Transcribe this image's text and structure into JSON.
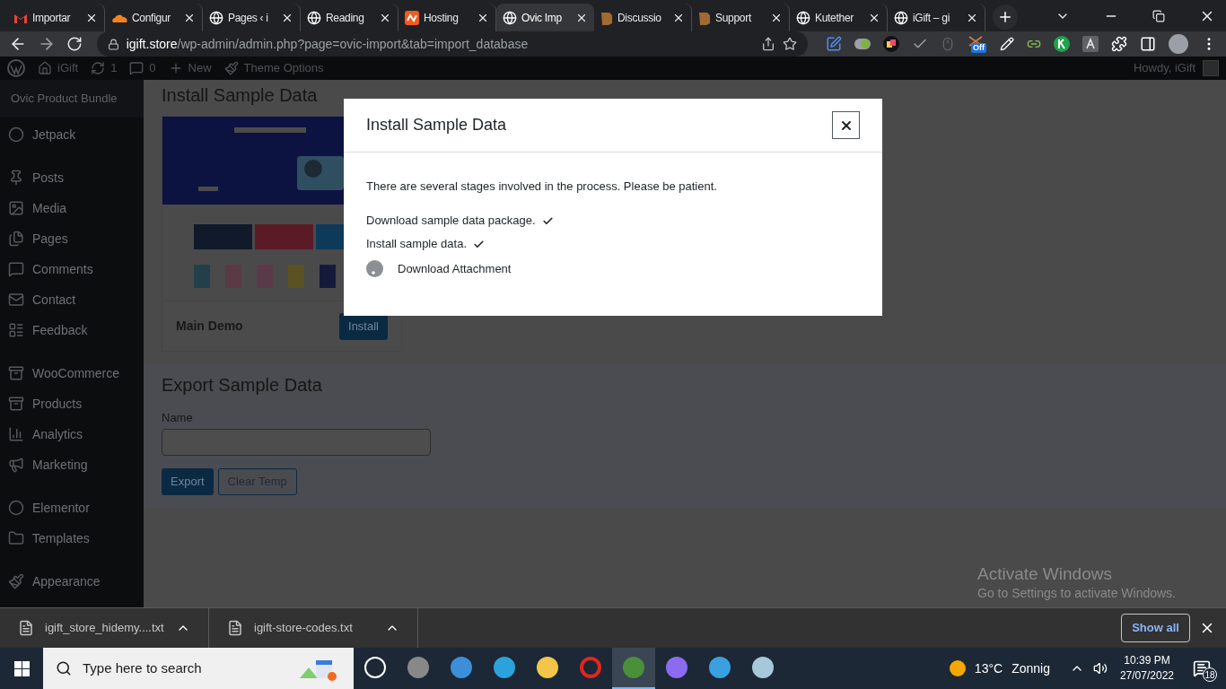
{
  "browser": {
    "tabs": [
      {
        "title": "Importar",
        "selected": false
      },
      {
        "title": "Configur",
        "selected": false
      },
      {
        "title": "Pages ‹ i",
        "selected": false
      },
      {
        "title": "Reading",
        "selected": false
      },
      {
        "title": "Hosting",
        "selected": false
      },
      {
        "title": "Ovic Imp",
        "selected": true
      },
      {
        "title": "Discussio",
        "selected": false
      },
      {
        "title": "Support",
        "selected": false
      },
      {
        "title": "Kutether",
        "selected": false
      },
      {
        "title": "iGift – gi",
        "selected": false
      }
    ],
    "address": {
      "host": "igift.store",
      "path": "/wp-admin/admin.php?page=ovic-import&tab=import_database"
    },
    "extension_badge": "Off"
  },
  "admin_bar": {
    "site": "iGift",
    "updates": "1",
    "comments": "0",
    "new": "New",
    "theme_options": "Theme Options",
    "howdy": "Howdy, iGift"
  },
  "sidebar": {
    "header": "Ovic Product Bundle",
    "groups": [
      [
        "Jetpack"
      ],
      [
        "Posts",
        "Media",
        "Pages",
        "Comments",
        "Contact",
        "Feedback"
      ],
      [
        "WooCommerce",
        "Products",
        "Analytics",
        "Marketing"
      ],
      [
        "Elementor",
        "Templates"
      ],
      [
        "Appearance"
      ]
    ]
  },
  "content": {
    "title": "Install Sample Data",
    "demo": {
      "name": "Main Demo",
      "button": "Install"
    },
    "export": {
      "title": "Export Sample Data",
      "name_label": "Name",
      "buttons": [
        "Export",
        "Clear Temp"
      ]
    }
  },
  "modal": {
    "title": "Install Sample Data",
    "intro": "There are several stages involved in the process. Please be patient.",
    "steps": [
      {
        "label": "Download sample data package.",
        "done": true
      },
      {
        "label": "Install sample data.",
        "done": true
      },
      {
        "label": "Download Attachment",
        "done": false
      }
    ]
  },
  "downloads": {
    "files": [
      "igift_store_hidemy....txt",
      "igift-store-codes.txt"
    ],
    "show_all": "Show all"
  },
  "activation_notice": {
    "title": "Activate Windows",
    "text": "Go to Settings to activate Windows."
  },
  "taskbar": {
    "search_placeholder": "Type here to search",
    "apps": [
      {
        "selected": false
      },
      {
        "selected": false
      },
      {
        "selected": false
      },
      {
        "selected": false
      },
      {
        "selected": false
      },
      {
        "selected": false
      },
      {
        "selected": true
      },
      {
        "selected": false
      },
      {
        "selected": false
      },
      {
        "selected": false
      }
    ],
    "temperature": "13°C",
    "weather": "Zonnig",
    "time": "10:39 PM",
    "date": "27/07/2022",
    "notifications": "18"
  }
}
